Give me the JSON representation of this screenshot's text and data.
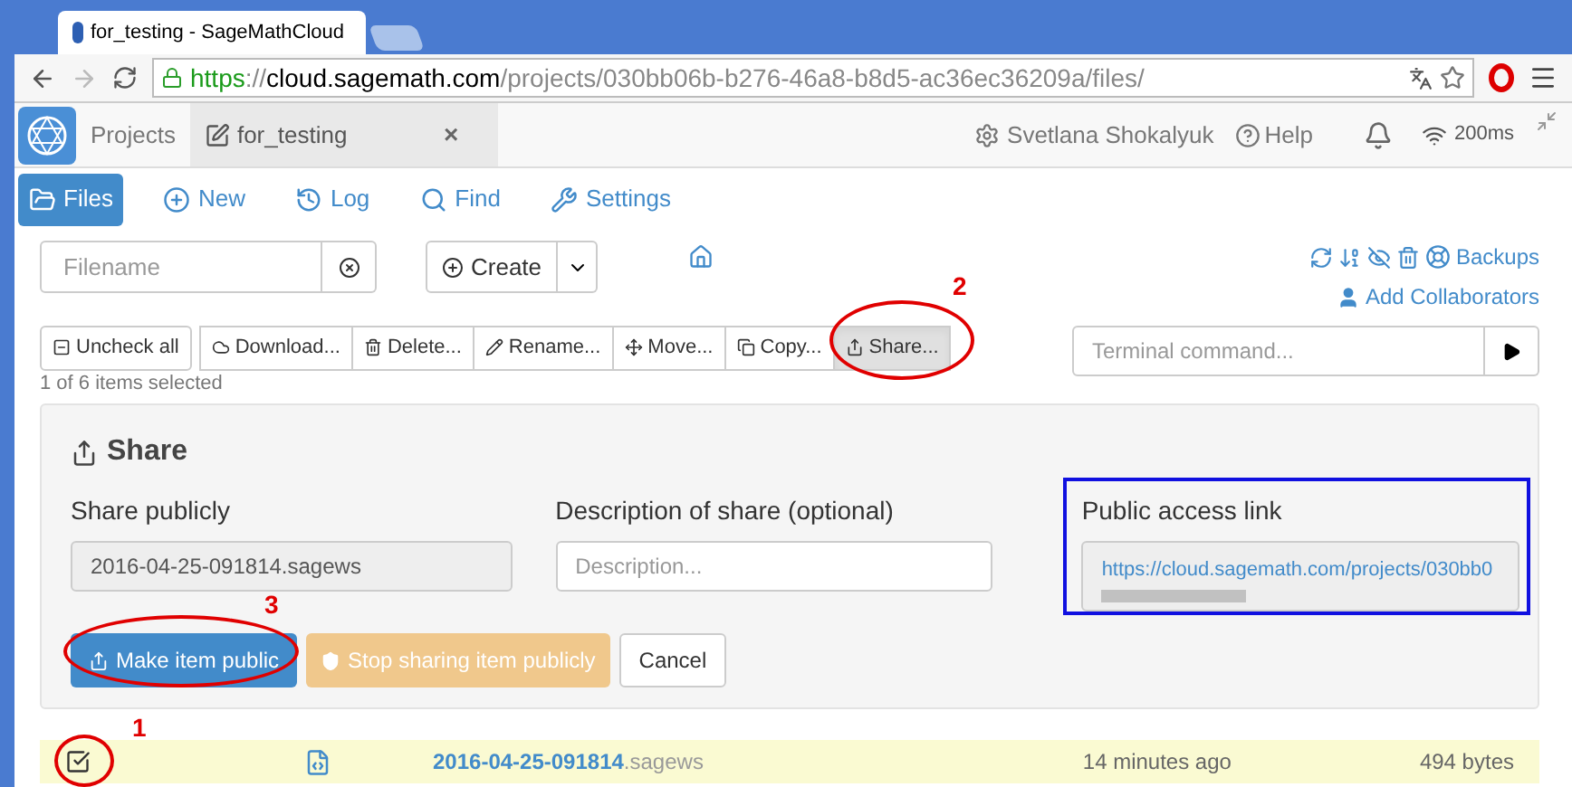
{
  "browser": {
    "tab_title": "for_testing - SageMathCloud",
    "url_scheme": "https",
    "url_sep": "://",
    "url_host": "cloud.sagemath.com",
    "url_path": "/projects/030bb06b-b276-46a8-b8d5-ac36ec36209a/files/"
  },
  "header": {
    "projects": "Projects",
    "project_tab": "for_testing",
    "close": "×",
    "user": "Svetlana Shokalyuk",
    "help": "Help",
    "ping": "200ms"
  },
  "nav": [
    {
      "label": "Files",
      "selected": true
    },
    {
      "label": "New",
      "selected": false
    },
    {
      "label": "Log",
      "selected": false
    },
    {
      "label": "Find",
      "selected": false
    },
    {
      "label": "Settings",
      "selected": false
    }
  ],
  "filename": {
    "placeholder": "Filename"
  },
  "create": "Create",
  "backups": "Backups",
  "add_collaborators": "Add Collaborators",
  "actions": [
    {
      "label": "Uncheck all",
      "selected": false
    },
    {
      "label": "Download...",
      "selected": false
    },
    {
      "label": "Delete...",
      "selected": false
    },
    {
      "label": "Rename...",
      "selected": false
    },
    {
      "label": "Move...",
      "selected": false
    },
    {
      "label": "Copy...",
      "selected": false
    },
    {
      "label": "Share...",
      "selected": true
    }
  ],
  "terminal": {
    "placeholder": "Terminal command..."
  },
  "selection_status": "1 of 6 items selected",
  "share": {
    "title": "Share",
    "share_label": "Share publicly",
    "share_value": "2016-04-25-091814.sagews",
    "desc_label": "Description of share (optional)",
    "desc_placeholder": "Description...",
    "link_label": "Public access link",
    "link": "https://cloud.sagemath.com/projects/030bb0",
    "make_public": "Make item public",
    "stop_sharing": "Stop sharing item publicly",
    "cancel": "Cancel"
  },
  "file": {
    "checked": true,
    "name": "2016-04-25-091814",
    "ext": ".sagews",
    "time": "14 minutes ago",
    "size": "494 bytes"
  },
  "annotations": [
    {
      "number": "2"
    },
    {
      "number": "3"
    },
    {
      "number": "1"
    }
  ]
}
